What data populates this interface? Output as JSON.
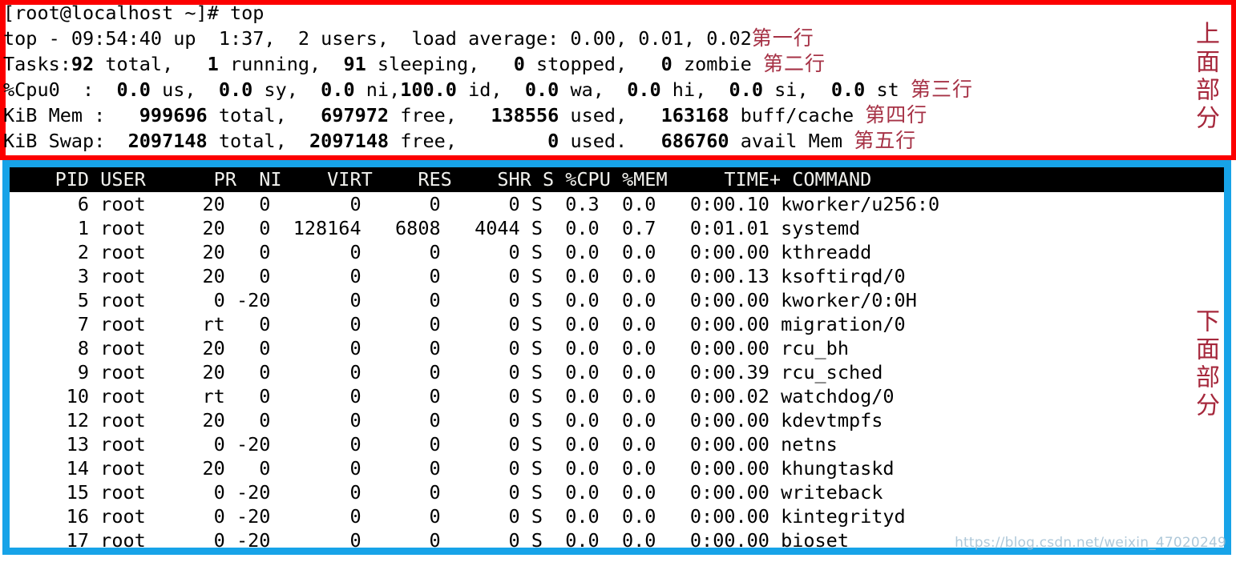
{
  "meta": {
    "colors": {
      "upper_box_border": "#fc0000",
      "lower_box_border": "#17a3e8",
      "annotation_text": "#a6283c",
      "header_bg": "#000000",
      "header_fg": "#f2f2ee",
      "terminal_bg": "#ffffff",
      "terminal_fg": "#000000"
    }
  },
  "terminal": {
    "prompt_line": "[root@localhost ~]# top",
    "summary": {
      "line1": {
        "label": "第一行",
        "text": "top - 09:54:40 up  1:37,  2 users,  load average: 0.00, 0.01, 0.02",
        "time": "09:54:40",
        "uptime": "1:37",
        "users": "2",
        "load_average": [
          "0.00",
          "0.01",
          "0.02"
        ]
      },
      "line2": {
        "label": "第二行",
        "prefix": "Tasks:",
        "total": "92",
        "total_word": " total,   ",
        "running": "1",
        "running_word": " running,  ",
        "sleeping": "91",
        "sleeping_word": " sleeping,   ",
        "stopped": "0",
        "stopped_word": " stopped,   ",
        "zombie": "0",
        "zombie_word": " zombie "
      },
      "line3": {
        "label": "第三行",
        "prefix": "%Cpu0  :  ",
        "us": "0.0",
        "us_word": " us,  ",
        "sy": "0.0",
        "sy_word": " sy,  ",
        "ni": "0.0",
        "ni_word": " ni,",
        "id": "100.0",
        "id_word": " id,  ",
        "wa": "0.0",
        "wa_word": " wa,  ",
        "hi": "0.0",
        "hi_word": " hi,  ",
        "si": "0.0",
        "si_word": " si,  ",
        "st": "0.0",
        "st_word": " st "
      },
      "line4": {
        "label": "第四行",
        "prefix": "KiB Mem :   ",
        "total": "999696",
        "total_word": " total,   ",
        "free": "697972",
        "free_word": " free,   ",
        "used": "138556",
        "used_word": " used,   ",
        "buffcache": "163168",
        "buffcache_word": " buff/cache "
      },
      "line5": {
        "label": "第五行",
        "prefix": "KiB Swap:  ",
        "total": "2097148",
        "total_word": " total,  ",
        "free": "2097148",
        "free_word": " free,        ",
        "used": "0",
        "used_word": " used.   ",
        "avail": "686760",
        "avail_word": " avail Mem "
      }
    },
    "table": {
      "header": "    PID USER      PR  NI    VIRT    RES    SHR S %CPU %MEM     TIME+ COMMAND",
      "columns": [
        "PID",
        "USER",
        "PR",
        "NI",
        "VIRT",
        "RES",
        "SHR",
        "S",
        "%CPU",
        "%MEM",
        "TIME+",
        "COMMAND"
      ],
      "rows": [
        {
          "pid": "6",
          "user": "root",
          "pr": "20",
          "ni": "0",
          "virt": "0",
          "res": "0",
          "shr": "0",
          "s": "S",
          "cpu": "0.3",
          "mem": "0.0",
          "time": "0:00.10",
          "command": "kworker/u256:0"
        },
        {
          "pid": "1",
          "user": "root",
          "pr": "20",
          "ni": "0",
          "virt": "128164",
          "res": "6808",
          "shr": "4044",
          "s": "S",
          "cpu": "0.0",
          "mem": "0.7",
          "time": "0:01.01",
          "command": "systemd"
        },
        {
          "pid": "2",
          "user": "root",
          "pr": "20",
          "ni": "0",
          "virt": "0",
          "res": "0",
          "shr": "0",
          "s": "S",
          "cpu": "0.0",
          "mem": "0.0",
          "time": "0:00.00",
          "command": "kthreadd"
        },
        {
          "pid": "3",
          "user": "root",
          "pr": "20",
          "ni": "0",
          "virt": "0",
          "res": "0",
          "shr": "0",
          "s": "S",
          "cpu": "0.0",
          "mem": "0.0",
          "time": "0:00.13",
          "command": "ksoftirqd/0"
        },
        {
          "pid": "5",
          "user": "root",
          "pr": "0",
          "ni": "-20",
          "virt": "0",
          "res": "0",
          "shr": "0",
          "s": "S",
          "cpu": "0.0",
          "mem": "0.0",
          "time": "0:00.00",
          "command": "kworker/0:0H"
        },
        {
          "pid": "7",
          "user": "root",
          "pr": "rt",
          "ni": "0",
          "virt": "0",
          "res": "0",
          "shr": "0",
          "s": "S",
          "cpu": "0.0",
          "mem": "0.0",
          "time": "0:00.00",
          "command": "migration/0"
        },
        {
          "pid": "8",
          "user": "root",
          "pr": "20",
          "ni": "0",
          "virt": "0",
          "res": "0",
          "shr": "0",
          "s": "S",
          "cpu": "0.0",
          "mem": "0.0",
          "time": "0:00.00",
          "command": "rcu_bh"
        },
        {
          "pid": "9",
          "user": "root",
          "pr": "20",
          "ni": "0",
          "virt": "0",
          "res": "0",
          "shr": "0",
          "s": "S",
          "cpu": "0.0",
          "mem": "0.0",
          "time": "0:00.39",
          "command": "rcu_sched"
        },
        {
          "pid": "10",
          "user": "root",
          "pr": "rt",
          "ni": "0",
          "virt": "0",
          "res": "0",
          "shr": "0",
          "s": "S",
          "cpu": "0.0",
          "mem": "0.0",
          "time": "0:00.02",
          "command": "watchdog/0"
        },
        {
          "pid": "12",
          "user": "root",
          "pr": "20",
          "ni": "0",
          "virt": "0",
          "res": "0",
          "shr": "0",
          "s": "S",
          "cpu": "0.0",
          "mem": "0.0",
          "time": "0:00.00",
          "command": "kdevtmpfs"
        },
        {
          "pid": "13",
          "user": "root",
          "pr": "0",
          "ni": "-20",
          "virt": "0",
          "res": "0",
          "shr": "0",
          "s": "S",
          "cpu": "0.0",
          "mem": "0.0",
          "time": "0:00.00",
          "command": "netns"
        },
        {
          "pid": "14",
          "user": "root",
          "pr": "20",
          "ni": "0",
          "virt": "0",
          "res": "0",
          "shr": "0",
          "s": "S",
          "cpu": "0.0",
          "mem": "0.0",
          "time": "0:00.00",
          "command": "khungtaskd"
        },
        {
          "pid": "15",
          "user": "root",
          "pr": "0",
          "ni": "-20",
          "virt": "0",
          "res": "0",
          "shr": "0",
          "s": "S",
          "cpu": "0.0",
          "mem": "0.0",
          "time": "0:00.00",
          "command": "writeback"
        },
        {
          "pid": "16",
          "user": "root",
          "pr": "0",
          "ni": "-20",
          "virt": "0",
          "res": "0",
          "shr": "0",
          "s": "S",
          "cpu": "0.0",
          "mem": "0.0",
          "time": "0:00.00",
          "command": "kintegrityd"
        },
        {
          "pid": "17",
          "user": "root",
          "pr": "0",
          "ni": "-20",
          "virt": "0",
          "res": "0",
          "shr": "0",
          "s": "S",
          "cpu": "0.0",
          "mem": "0.0",
          "time": "0:00.00",
          "command": "bioset"
        }
      ]
    }
  },
  "annotations": {
    "upper_region": "上面部分",
    "lower_region": "下面部分"
  },
  "watermark": "https://blog.csdn.net/weixin_47020249"
}
